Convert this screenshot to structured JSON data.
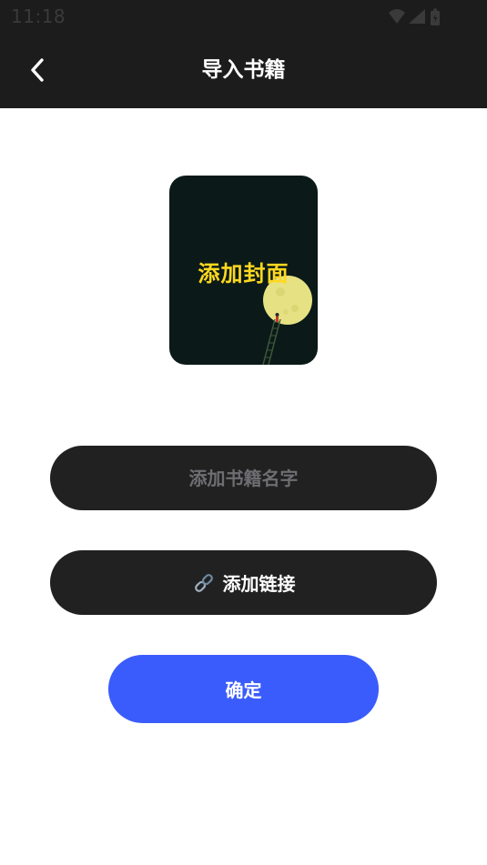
{
  "status_bar": {
    "time": "11:18",
    "icons": [
      "wifi-icon",
      "signal-icon",
      "battery-icon"
    ]
  },
  "header": {
    "title": "导入书籍",
    "back_icon": "chevron-left-icon"
  },
  "cover": {
    "label": "添加封面"
  },
  "name_field": {
    "placeholder": "添加书籍名字",
    "value": ""
  },
  "link_button": {
    "icon": "link-icon",
    "label": "添加链接"
  },
  "confirm_button": {
    "label": "确定"
  },
  "colors": {
    "header_bg": "#1c1c1d",
    "pill_bg": "#212121",
    "accent": "#3b5cfc",
    "cover_text": "#ffd81f",
    "placeholder": "#6e6e72"
  }
}
